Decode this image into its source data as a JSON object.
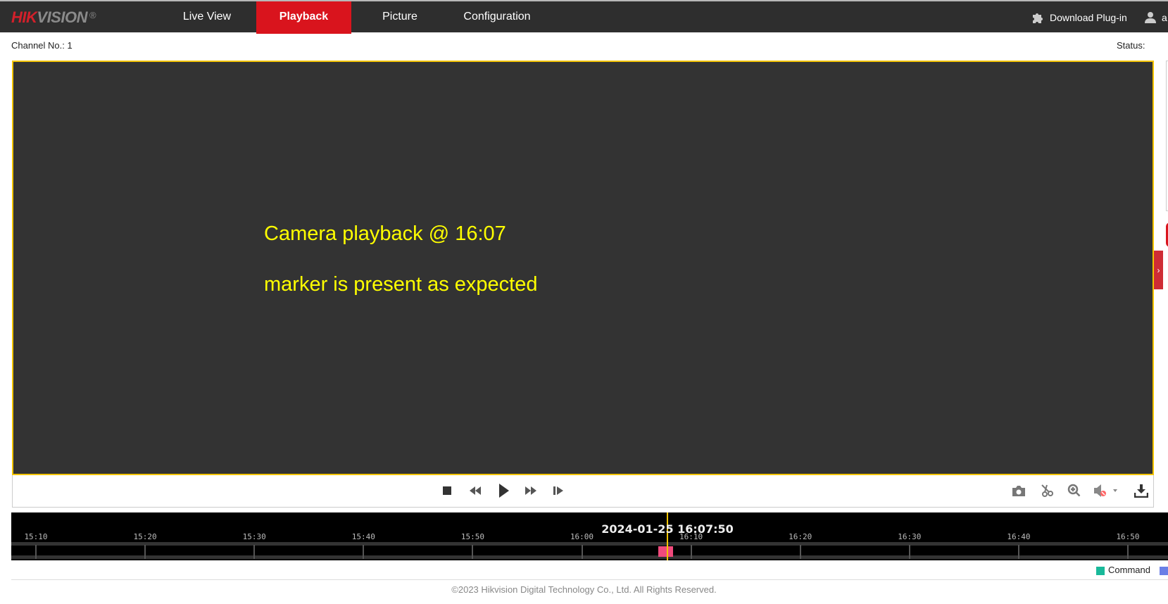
{
  "header": {
    "logo": {
      "brand_red": "HIK",
      "brand_gray": "VISION",
      "mark": "®"
    },
    "nav": [
      {
        "label": "Live View",
        "active": false
      },
      {
        "label": "Playback",
        "active": true
      },
      {
        "label": "Picture",
        "active": false
      },
      {
        "label": "Configuration",
        "active": false
      }
    ],
    "download_plugin": "Download Plug-in",
    "user": "a"
  },
  "channel_label": "Channel No.: 1",
  "status_label": "Status:",
  "video": {
    "osd_line1": "Camera playback @ 16:07",
    "osd_line2": "marker is present as expected"
  },
  "controls": {
    "left": [
      "stop-icon",
      "slow-forward-icon",
      "play-icon",
      "fast-forward-icon",
      "single-frame-icon"
    ],
    "right": [
      "capture-icon",
      "clip-icon",
      "digital-zoom-icon",
      "audio-muted-icon",
      "download-icon"
    ]
  },
  "timeline": {
    "datetime": "2024-01-25 16:07:50",
    "labels": [
      "15:10",
      "15:20",
      "15:30",
      "15:40",
      "15:50",
      "16:00",
      "16:10",
      "16:20",
      "16:30",
      "16:40",
      "16:50"
    ],
    "cursor_time": "16:07:50",
    "record_segment": {
      "start": "16:07",
      "end": "16:08:20",
      "color": "#f04a7c"
    }
  },
  "legend": [
    {
      "label": "Command",
      "color": "#19b99a"
    },
    {
      "label": "",
      "color": "#6b7fe6"
    }
  ],
  "footer": "©2023 Hikvision Digital Technology Co., Ltd. All Rights Reserved.",
  "colors": {
    "accent": "#d9141d",
    "video_border": "#f3c400",
    "cursor": "#f3c400"
  }
}
